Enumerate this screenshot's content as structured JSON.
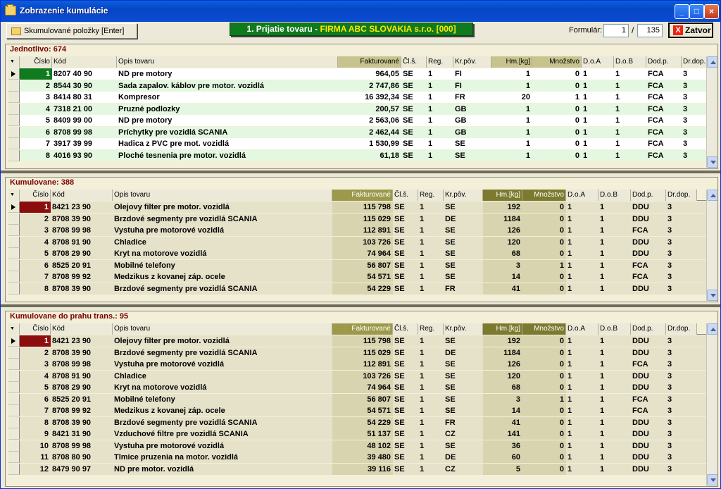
{
  "window": {
    "title": "Zobrazenie kumulácie"
  },
  "toolbar": {
    "cumulate_label": "Skumulované položky [Enter]",
    "banner_prefix": "1. Prijatie tovaru - ",
    "banner_text": "FIRMA ABC SLOVAKIA s.r.o.  [000]",
    "forms_label": "Formulár:",
    "form_current": "1",
    "form_sep": "/",
    "form_total": "135",
    "close_label": "Zatvor"
  },
  "columns_a": [
    "Číslo",
    "Kód",
    "Opis tovaru",
    "Fakturované",
    "Čl.š.",
    "Reg.",
    "Kr.pôv.",
    "Hm.[kg]",
    "Množstvo",
    "D.o.A",
    "D.o.B",
    "Dod.p.",
    "Dr.dop."
  ],
  "columns_b": [
    "Číslo",
    "Kód",
    "Opis tovaru",
    "Fakturované",
    "Čl.š.",
    "Reg.",
    "Kr.pôv.",
    "Hm.[kg]",
    "Množstvo",
    "D.o.A",
    "D.o.B",
    "Dod.p.",
    "Dr.dop."
  ],
  "colors": {
    "row_even": "#ffffff",
    "row_odd": "#e4f7e0",
    "row_b": "#e6e2c9",
    "sel_a": "#0f7a1e",
    "sel_b": "#8b0d0d"
  },
  "panel1": {
    "title": "Jednotlivo: 674",
    "rows": [
      [
        "1",
        "8207 40 90",
        "ND pre motory",
        "964,05",
        "SE",
        "1",
        "FI",
        "1",
        "0",
        "1",
        "1",
        "FCA",
        "3"
      ],
      [
        "2",
        "8544 30 90",
        "Sada zapalov. káblov pre motor. vozidlá",
        "2 747,86",
        "SE",
        "1",
        "FI",
        "1",
        "0",
        "1",
        "1",
        "FCA",
        "3"
      ],
      [
        "3",
        "8414 80 31",
        "Kompresor",
        "16 392,34",
        "SE",
        "1",
        "FR",
        "20",
        "1",
        "1",
        "1",
        "FCA",
        "3"
      ],
      [
        "4",
        "7318 21 00",
        "Pruzné podlozky",
        "200,57",
        "SE",
        "1",
        "GB",
        "1",
        "0",
        "1",
        "1",
        "FCA",
        "3"
      ],
      [
        "5",
        "8409 99 00",
        "ND pre motory",
        "2 563,06",
        "SE",
        "1",
        "GB",
        "1",
        "0",
        "1",
        "1",
        "FCA",
        "3"
      ],
      [
        "6",
        "8708 99 98",
        "Príchytky pre vozidlá SCANIA",
        "2 462,44",
        "SE",
        "1",
        "GB",
        "1",
        "0",
        "1",
        "1",
        "FCA",
        "3"
      ],
      [
        "7",
        "3917 39 99",
        "Hadica z PVC pre mot. vozidlá",
        "1 530,99",
        "SE",
        "1",
        "SE",
        "1",
        "0",
        "1",
        "1",
        "FCA",
        "3"
      ],
      [
        "8",
        "4016 93 90",
        "Ploché tesnenia pre motor. vozidlá",
        "61,18",
        "SE",
        "1",
        "SE",
        "1",
        "0",
        "1",
        "1",
        "FCA",
        "3"
      ]
    ]
  },
  "panel2": {
    "title": "Kumulovane: 388",
    "rows": [
      [
        "1",
        "8421 23 90",
        "Olejovy filter pre motor. vozidlá",
        "115 798",
        "SE",
        "1",
        "SE",
        "192",
        "0",
        "1",
        "1",
        "DDU",
        "3"
      ],
      [
        "2",
        "8708 39 90",
        "Brzdové segmenty pre vozidlá SCANIA",
        "115 029",
        "SE",
        "1",
        "DE",
        "1184",
        "0",
        "1",
        "1",
        "DDU",
        "3"
      ],
      [
        "3",
        "8708 99 98",
        "Vystuha pre motorové vozidlá",
        "112 891",
        "SE",
        "1",
        "SE",
        "126",
        "0",
        "1",
        "1",
        "FCA",
        "3"
      ],
      [
        "4",
        "8708 91 90",
        "Chladice",
        "103 726",
        "SE",
        "1",
        "SE",
        "120",
        "0",
        "1",
        "1",
        "DDU",
        "3"
      ],
      [
        "5",
        "8708 29 90",
        "Kryt na motorove vozidlá",
        "74 964",
        "SE",
        "1",
        "SE",
        "68",
        "0",
        "1",
        "1",
        "DDU",
        "3"
      ],
      [
        "6",
        "8525 20 91",
        "Mobilné telefony",
        "56 807",
        "SE",
        "1",
        "SE",
        "3",
        "1",
        "1",
        "1",
        "FCA",
        "3"
      ],
      [
        "7",
        "8708 99 92",
        "Medzikus z kovanej záp. ocele",
        "54 571",
        "SE",
        "1",
        "SE",
        "14",
        "0",
        "1",
        "1",
        "FCA",
        "3"
      ],
      [
        "8",
        "8708 39 90",
        "Brzdové segmenty pre vozidlá SCANIA",
        "54 229",
        "SE",
        "1",
        "FR",
        "41",
        "0",
        "1",
        "1",
        "DDU",
        "3"
      ]
    ]
  },
  "panel3": {
    "title": "Kumulovane do prahu trans.: 95",
    "rows": [
      [
        "1",
        "8421 23 90",
        "Olejovy filter pre motor. vozidlá",
        "115 798",
        "SE",
        "1",
        "SE",
        "192",
        "0",
        "1",
        "1",
        "DDU",
        "3"
      ],
      [
        "2",
        "8708 39 90",
        "Brzdové segmenty pre vozidlá SCANIA",
        "115 029",
        "SE",
        "1",
        "DE",
        "1184",
        "0",
        "1",
        "1",
        "DDU",
        "3"
      ],
      [
        "3",
        "8708 99 98",
        "Vystuha pre motorové vozidlá",
        "112 891",
        "SE",
        "1",
        "SE",
        "126",
        "0",
        "1",
        "1",
        "FCA",
        "3"
      ],
      [
        "4",
        "8708 91 90",
        "Chladice",
        "103 726",
        "SE",
        "1",
        "SE",
        "120",
        "0",
        "1",
        "1",
        "DDU",
        "3"
      ],
      [
        "5",
        "8708 29 90",
        "Kryt na motorove vozidlá",
        "74 964",
        "SE",
        "1",
        "SE",
        "68",
        "0",
        "1",
        "1",
        "DDU",
        "3"
      ],
      [
        "6",
        "8525 20 91",
        "Mobilné telefony",
        "56 807",
        "SE",
        "1",
        "SE",
        "3",
        "1",
        "1",
        "1",
        "FCA",
        "3"
      ],
      [
        "7",
        "8708 99 92",
        "Medzikus z kovanej záp. ocele",
        "54 571",
        "SE",
        "1",
        "SE",
        "14",
        "0",
        "1",
        "1",
        "FCA",
        "3"
      ],
      [
        "8",
        "8708 39 90",
        "Brzdové segmenty pre vozidlá SCANIA",
        "54 229",
        "SE",
        "1",
        "FR",
        "41",
        "0",
        "1",
        "1",
        "DDU",
        "3"
      ],
      [
        "9",
        "8421 31 90",
        "Vzduchové filtre pre vozidlá SCANIA",
        "51 137",
        "SE",
        "1",
        "CZ",
        "141",
        "0",
        "1",
        "1",
        "DDU",
        "3"
      ],
      [
        "10",
        "8708 99 98",
        "Vystuha pre motorové vozidlá",
        "48 102",
        "SE",
        "1",
        "SE",
        "36",
        "0",
        "1",
        "1",
        "DDU",
        "3"
      ],
      [
        "11",
        "8708 80 90",
        "Tlmice pruzenia na motor. vozidlá",
        "39 480",
        "SE",
        "1",
        "DE",
        "60",
        "0",
        "1",
        "1",
        "DDU",
        "3"
      ],
      [
        "12",
        "8479 90 97",
        "ND pre motor. vozidlá",
        "39 116",
        "SE",
        "1",
        "CZ",
        "5",
        "0",
        "1",
        "1",
        "DDU",
        "3"
      ]
    ]
  }
}
